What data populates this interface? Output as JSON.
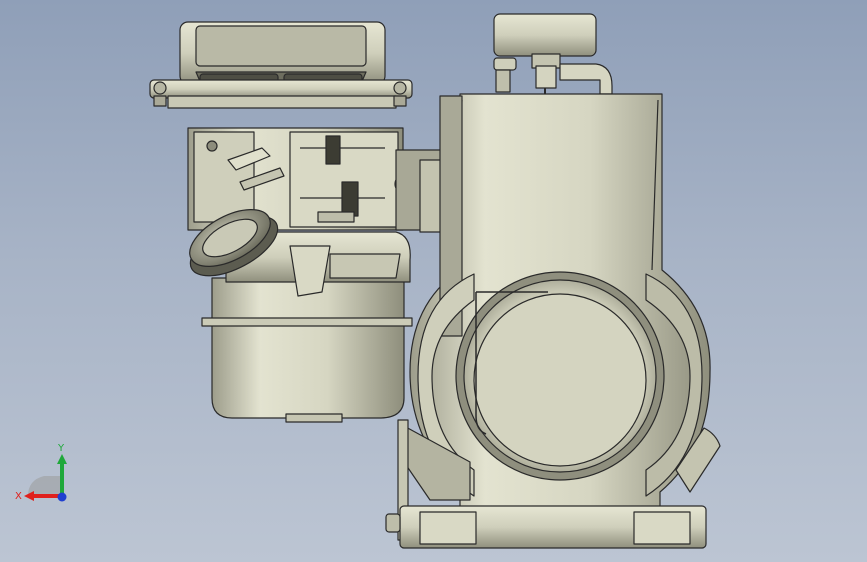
{
  "viewport": {
    "background_top": "#8f9fb8",
    "background_bottom": "#bcc5d3"
  },
  "model": {
    "name": "engine-assembly",
    "body_color": "#d8d8c4",
    "shadow_color": "#8f8f7e",
    "edge_color": "#2a2a2a"
  },
  "triad": {
    "x_label": "X",
    "y_label": "Y",
    "x_color": "#e0201c",
    "y_color": "#1fa83a",
    "z_color": "#1f3fd0"
  }
}
